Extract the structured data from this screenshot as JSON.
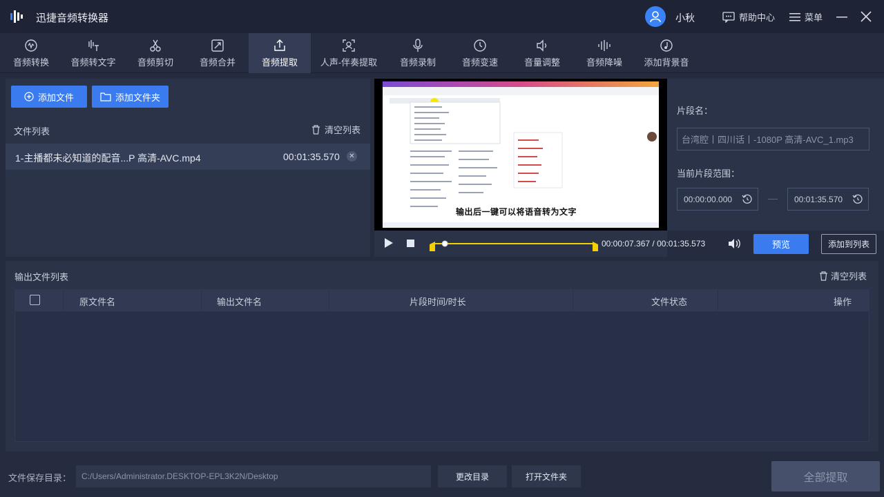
{
  "app": {
    "title": "迅捷音频转换器",
    "username": "小秋",
    "help_label": "帮助中心",
    "menu_label": "菜单"
  },
  "tools": [
    {
      "label": "音频转换",
      "icon": "audio-convert-icon"
    },
    {
      "label": "音频转文字",
      "icon": "audio-to-text-icon"
    },
    {
      "label": "音频剪切",
      "icon": "scissors-icon"
    },
    {
      "label": "音频合并",
      "icon": "merge-icon"
    },
    {
      "label": "音频提取",
      "icon": "extract-icon",
      "active": true
    },
    {
      "label": "人声-伴奏提取",
      "icon": "vocal-separate-icon"
    },
    {
      "label": "音频录制",
      "icon": "microphone-icon"
    },
    {
      "label": "音频变速",
      "icon": "speed-icon"
    },
    {
      "label": "音量调整",
      "icon": "volume-icon"
    },
    {
      "label": "音频降噪",
      "icon": "denoise-icon"
    },
    {
      "label": "添加背景音",
      "icon": "background-music-icon"
    }
  ],
  "left": {
    "add_file": "添加文件",
    "add_folder": "添加文件夹",
    "file_list_label": "文件列表",
    "clear_list": "清空列表",
    "files": [
      {
        "name": "1-主播都未必知道的配音...P 高清-AVC.mp4",
        "duration": "00:01:35.570"
      }
    ]
  },
  "player": {
    "subtitle": "输出后一键可以将语音转为文字",
    "current_time": "00:00:07.367",
    "separator": "/",
    "total_time": "00:01:35.573",
    "progress_fraction": 0.077,
    "preview": "预览",
    "add_to_list": "添加到列表"
  },
  "segment": {
    "name_label": "片段名：",
    "name_value": "台湾腔丨四川话丨-1080P 高清-AVC_1.mp3",
    "range_label": "当前片段范围：",
    "start": "00:00:00.000",
    "end": "00:01:35.570"
  },
  "output": {
    "label": "输出文件列表",
    "clear_list": "清空列表",
    "columns": [
      "原文件名",
      "输出文件名",
      "片段时间/时长",
      "文件状态",
      "操作"
    ]
  },
  "bottom": {
    "save_label": "文件保存目录：",
    "save_path": "C:/Users/Administrator.DESKTOP-EPL3K2N/Desktop",
    "change_dir": "更改目录",
    "open_folder": "打开文件夹",
    "extract_all": "全部提取"
  },
  "colors": {
    "accent": "#3a7cf0",
    "timeline": "#f5d000",
    "background": "#252c3f"
  }
}
